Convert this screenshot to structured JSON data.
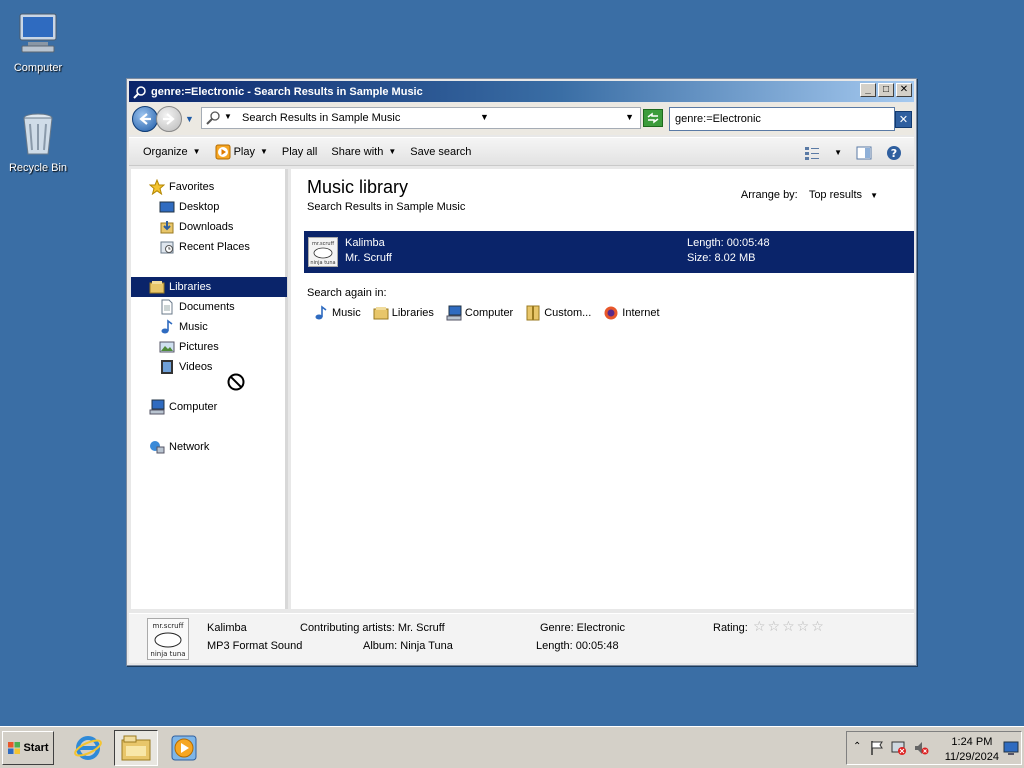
{
  "desktop": {
    "icons": [
      {
        "label": "Computer",
        "icon": "computer-icon"
      },
      {
        "label": "Recycle Bin",
        "icon": "recycle-bin-icon"
      }
    ]
  },
  "window": {
    "title": "genre:=Electronic - Search Results in Sample Music",
    "controls": {
      "minimize": "_",
      "maximize": "□",
      "close": "✕"
    }
  },
  "address": {
    "breadcrumb": "Search Results in Sample Music",
    "search_value": "genre:=Electronic"
  },
  "toolbar": {
    "organize": "Organize",
    "play": "Play",
    "play_all": "Play all",
    "share_with": "Share with",
    "save_search": "Save search"
  },
  "nav": {
    "favorites": "Favorites",
    "desktop": "Desktop",
    "downloads": "Downloads",
    "recent_places": "Recent Places",
    "libraries": "Libraries",
    "documents": "Documents",
    "music": "Music",
    "pictures": "Pictures",
    "videos": "Videos",
    "computer": "Computer",
    "network": "Network"
  },
  "content": {
    "title": "Music library",
    "subtitle": "Search Results in Sample Music",
    "arrange_label": "Arrange by:",
    "arrange_value": "Top results",
    "result": {
      "name": "Kalimba",
      "artist": "Mr. Scruff",
      "length": "Length: 00:05:48",
      "size": "Size: 8.02 MB"
    },
    "search_again_label": "Search again in:",
    "search_again": [
      {
        "label": "Music",
        "icon": "music-note-icon"
      },
      {
        "label": "Libraries",
        "icon": "libraries-folder-icon"
      },
      {
        "label": "Computer",
        "icon": "computer-icon"
      },
      {
        "label": "Custom...",
        "icon": "custom-folder-icon"
      },
      {
        "label": "Internet",
        "icon": "internet-icon"
      }
    ]
  },
  "details": {
    "name": "Kalimba",
    "type": "MP3 Format Sound",
    "contributing_artists": "Contributing artists: Mr. Scruff",
    "album": "Album: Ninja Tuna",
    "genre": "Genre: Electronic",
    "length": "Length: 00:05:48",
    "rating_label": "Rating:",
    "rating_stars": "☆☆☆☆☆",
    "album_art_text": "mr.scruff ninja tuna"
  },
  "taskbar": {
    "start": "Start",
    "time": "1:24 PM",
    "date": "11/29/2024"
  }
}
